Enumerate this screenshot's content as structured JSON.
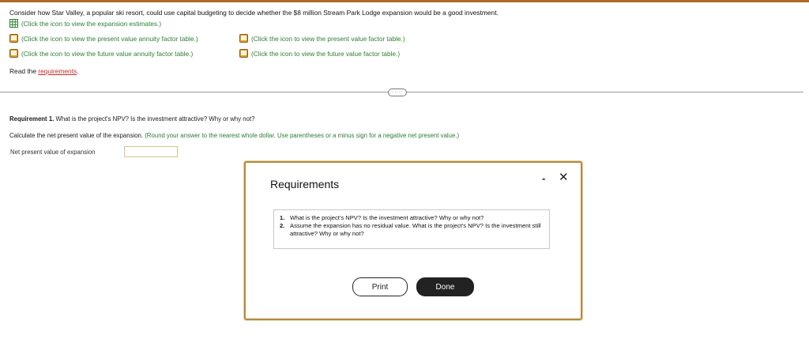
{
  "intro_text": "Consider how Star Valley, a popular ski resort, could use capital budgeting to decide whether the $8 million Stream Park Lodge expansion would be a good investment.",
  "links": {
    "expansion_estimates": "(Click the icon to view the expansion estimates.)",
    "pv_annuity": "(Click the icon to view the present value annuity factor table.)",
    "pv_factor": "(Click the icon to view the present value factor table.)",
    "fv_annuity": "(Click the icon to view the future value annuity factor table.)",
    "fv_factor": "(Click the icon to view the future value factor table.)"
  },
  "read_prefix": "Read the ",
  "read_link": "requirements",
  "read_suffix": ".",
  "divider_pill": "·····",
  "requirement1": {
    "label": "Requirement 1.",
    "question": " What is the project's NPV? Is the investment attractive? Why or why not?"
  },
  "calculate": {
    "text": "Calculate the net present value of the expansion.",
    "hint": " (Round your answer to the nearest whole dollar. Use parentheses or a minus sign for a negative net present value.)"
  },
  "npv_field": {
    "label": "Net present value of expansion",
    "value": ""
  },
  "modal": {
    "title": "Requirements",
    "minimize": "-",
    "close": "✕",
    "items": [
      {
        "num": "1.",
        "text": "What is the project's NPV? Is the investment attractive? Why or why not?"
      },
      {
        "num": "2.",
        "text": "Assume the expansion has no residual value. What is the project's NPV? Is the investment still attractive? Why or why not?"
      }
    ],
    "print_label": "Print",
    "done_label": "Done"
  },
  "colors": {
    "accent_green": "#2e7d32",
    "link_red": "#c62828",
    "modal_border": "#b58a3c",
    "top_bar": "#b06a2a"
  }
}
